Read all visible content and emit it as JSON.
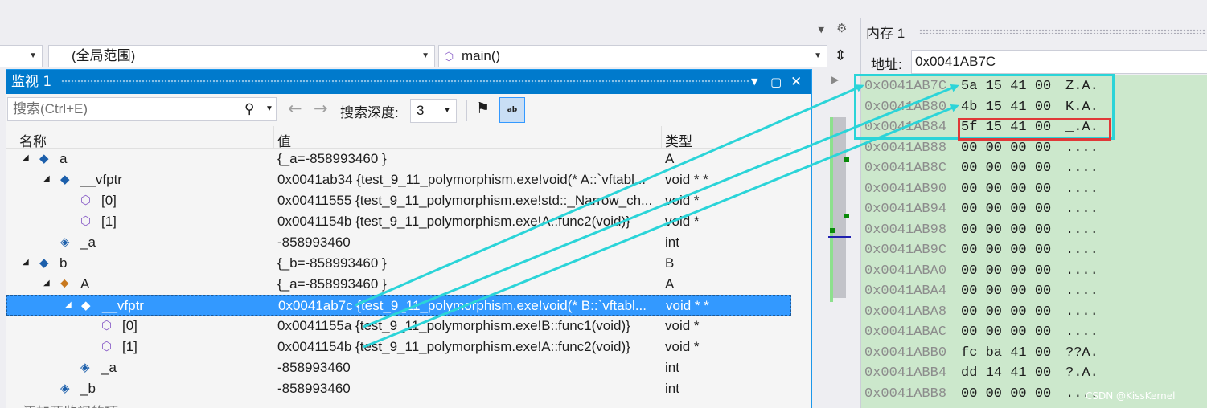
{
  "colors": {
    "accent": "#007acc",
    "selection": "#3399ff",
    "arrow": "#2bd4d8",
    "highlight_red": "#e03838",
    "memory_bg": "#cce8cc"
  },
  "scope": {
    "global_scope": "(全局范围)",
    "function": "main()"
  },
  "watch": {
    "title": "监视 1",
    "search_placeholder": "搜索(Ctrl+E)",
    "depth_label": "搜索深度:",
    "depth_value": "3",
    "columns": {
      "name": "名称",
      "value": "值",
      "type": "类型"
    },
    "rows": [
      {
        "name": "a",
        "value": "{_a=-858993460 }",
        "type": "A",
        "icon": "object-icon"
      },
      {
        "name": "__vfptr",
        "value": "0x0041ab34 {test_9_11_polymorphism.exe!void(* A::`vftabl...",
        "type": "void * *",
        "icon": "object-icon"
      },
      {
        "name": "[0]",
        "value": "0x00411555 {test_9_11_polymorphism.exe!std::_Narrow_ch...",
        "type": "void *",
        "icon": "cube-icon"
      },
      {
        "name": "[1]",
        "value": "0x0041154b {test_9_11_polymorphism.exe!A::func2(void)}",
        "type": "void *",
        "icon": "cube-icon"
      },
      {
        "name": "_a",
        "value": "-858993460",
        "type": "int",
        "icon": "field-icon"
      },
      {
        "name": "b",
        "value": "{_b=-858993460 }",
        "type": "B",
        "icon": "object-icon"
      },
      {
        "name": "A",
        "value": "{_a=-858993460 }",
        "type": "A",
        "icon": "base-class-icon"
      },
      {
        "name": "__vfptr",
        "value": "0x0041ab7c {test_9_11_polymorphism.exe!void(* B::`vftabl...",
        "type": "void * *",
        "icon": "object-icon"
      },
      {
        "name": "[0]",
        "value": "0x0041155a {test_9_11_polymorphism.exe!B::func1(void)}",
        "type": "void *",
        "icon": "cube-icon"
      },
      {
        "name": "[1]",
        "value": "0x0041154b {test_9_11_polymorphism.exe!A::func2(void)}",
        "type": "void *",
        "icon": "cube-icon"
      },
      {
        "name": "_a",
        "value": "-858993460",
        "type": "int",
        "icon": "field-icon"
      },
      {
        "name": "_b",
        "value": "-858993460",
        "type": "int",
        "icon": "field-icon"
      }
    ],
    "add_item_text": "添加要监视的项"
  },
  "memory": {
    "title": "内存 1",
    "address_label": "地址:",
    "address_value": "0x0041AB7C",
    "rows": [
      {
        "addr": "0x0041AB7C",
        "bytes": "5a 15 41 00",
        "chars": "Z.A."
      },
      {
        "addr": "0x0041AB80",
        "bytes": "4b 15 41 00",
        "chars": "K.A."
      },
      {
        "addr": "0x0041AB84",
        "bytes": "5f 15 41 00",
        "chars": "_.A."
      },
      {
        "addr": "0x0041AB88",
        "bytes": "00 00 00 00",
        "chars": "...."
      },
      {
        "addr": "0x0041AB8C",
        "bytes": "00 00 00 00",
        "chars": "...."
      },
      {
        "addr": "0x0041AB90",
        "bytes": "00 00 00 00",
        "chars": "...."
      },
      {
        "addr": "0x0041AB94",
        "bytes": "00 00 00 00",
        "chars": "...."
      },
      {
        "addr": "0x0041AB98",
        "bytes": "00 00 00 00",
        "chars": "...."
      },
      {
        "addr": "0x0041AB9C",
        "bytes": "00 00 00 00",
        "chars": "...."
      },
      {
        "addr": "0x0041ABA0",
        "bytes": "00 00 00 00",
        "chars": "...."
      },
      {
        "addr": "0x0041ABA4",
        "bytes": "00 00 00 00",
        "chars": "...."
      },
      {
        "addr": "0x0041ABA8",
        "bytes": "00 00 00 00",
        "chars": "...."
      },
      {
        "addr": "0x0041ABAC",
        "bytes": "00 00 00 00",
        "chars": "...."
      },
      {
        "addr": "0x0041ABB0",
        "bytes": "fc ba 41 00",
        "chars": "??A."
      },
      {
        "addr": "0x0041ABB4",
        "bytes": "dd 14 41 00",
        "chars": "?.A."
      },
      {
        "addr": "0x0041ABB8",
        "bytes": "00 00 00 00",
        "chars": "...."
      }
    ]
  },
  "watermark": "CSDN @KissKernel"
}
